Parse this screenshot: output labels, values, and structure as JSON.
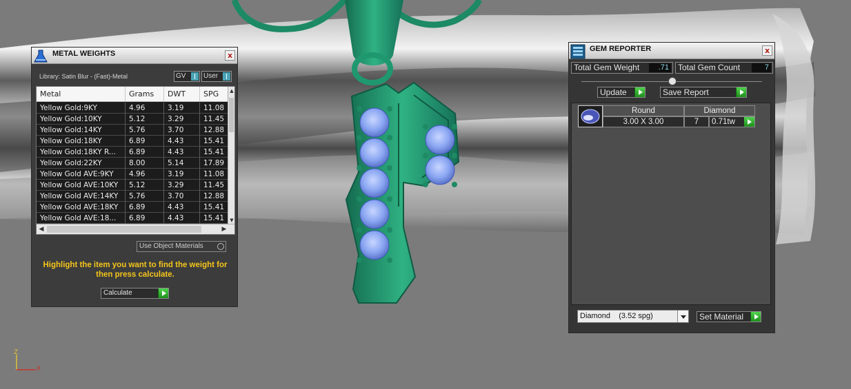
{
  "metal_weights": {
    "title": "METAL WEIGHTS",
    "close": "x",
    "library_label": "Library: Satin Blur - (Fast)-Metal",
    "toggle_gv": "GV",
    "toggle_user": "User",
    "columns": [
      "Metal",
      "Grams",
      "DWT",
      "SPG"
    ],
    "rows": [
      [
        "Yellow Gold:9KY",
        "4.96",
        "3.19",
        "11.08"
      ],
      [
        "Yellow Gold:10KY",
        "5.12",
        "3.29",
        "11.45"
      ],
      [
        "Yellow Gold:14KY",
        "5.76",
        "3.70",
        "12.88"
      ],
      [
        "Yellow Gold:18KY",
        "6.89",
        "4.43",
        "15.41"
      ],
      [
        "Yellow Gold:18KY R...",
        "6.89",
        "4.43",
        "15.41"
      ],
      [
        "Yellow Gold:22KY",
        "8.00",
        "5.14",
        "17.89"
      ],
      [
        "Yellow Gold AVE:9KY",
        "4.96",
        "3.19",
        "11.08"
      ],
      [
        "Yellow Gold AVE:10KY",
        "5.12",
        "3.29",
        "11.45"
      ],
      [
        "Yellow Gold AVE:14KY",
        "5.76",
        "3.70",
        "12.88"
      ],
      [
        "Yellow Gold AVE:18KY",
        "6.89",
        "4.43",
        "15.41"
      ],
      [
        "Yellow Gold AVE:18...",
        "6.89",
        "4.43",
        "15.41"
      ]
    ],
    "use_object_materials": "Use Object Materials",
    "hint": "Highlight the item you want to find the weight for then press calculate.",
    "calculate": "Calculate"
  },
  "gem_reporter": {
    "title": "GEM REPORTER",
    "close": "x",
    "total_weight_label": "Total Gem Weight",
    "total_weight_value": ".71",
    "total_count_label": "Total Gem Count",
    "total_count_value": "7",
    "update": "Update",
    "save_report": "Save Report",
    "gem": {
      "shape": "Round",
      "material": "Diamond",
      "size": "3.00 X 3.00",
      "count": "7",
      "weight": "0.71tw"
    },
    "material_select": "Diamond    (3.52 spg)",
    "set_material": "Set Material"
  },
  "axis": {
    "z": "Z",
    "x": "X"
  }
}
